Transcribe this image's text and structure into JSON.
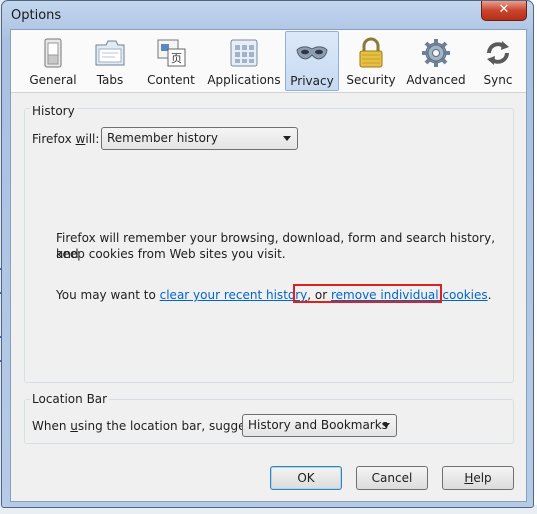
{
  "window": {
    "title": "Options",
    "close_glyph": "✕"
  },
  "toolbar": {
    "items": [
      {
        "label": "General",
        "icon": "switch-icon"
      },
      {
        "label": "Tabs",
        "icon": "tabs-icon"
      },
      {
        "label": "Content",
        "icon": "content-icon"
      },
      {
        "label": "Applications",
        "icon": "applications-icon"
      },
      {
        "label": "Privacy",
        "icon": "privacy-mask-icon",
        "selected": true
      },
      {
        "label": "Security",
        "icon": "padlock-icon"
      },
      {
        "label": "Advanced",
        "icon": "gear-icon"
      },
      {
        "label": "Sync",
        "icon": "sync-icon"
      }
    ]
  },
  "history": {
    "group_label": "History",
    "will_label_pre": "Firefox ",
    "will_label_access": "w",
    "will_label_post": "ill:",
    "dropdown_value": "Remember history",
    "description_line1": "Firefox will remember your browsing, download, form and search history, and",
    "description_line2": "keep cookies from Web sites you visit.",
    "may_want_pre": "You may want to ",
    "clear_link": "clear your recent history",
    "may_want_mid": ", or ",
    "remove_link": "remove individual cookies",
    "may_want_post": "."
  },
  "location_bar": {
    "group_label": "Location Bar",
    "suggest_pre": "When ",
    "suggest_access": "u",
    "suggest_post": "sing the location bar, suggest:",
    "dropdown_value": "History and Bookmarks"
  },
  "buttons": {
    "ok": "OK",
    "cancel": "Cancel",
    "help_access": "H",
    "help_rest": "elp"
  },
  "colors": {
    "link": "#0066cc",
    "highlight": "#e02020",
    "selected_tab": "#c6daf2"
  }
}
